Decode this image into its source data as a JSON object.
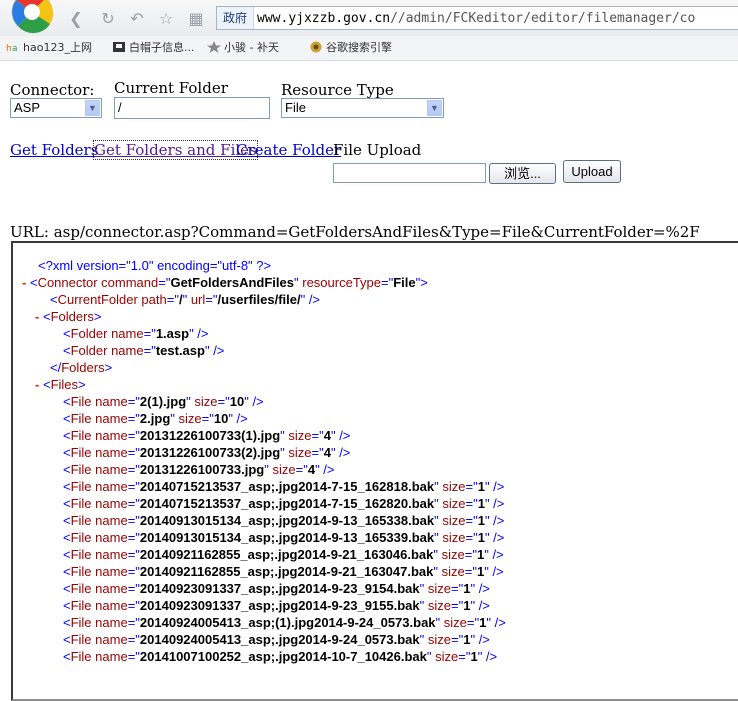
{
  "browser": {
    "zone_label": "政府",
    "address_main": "www.yjxzzb.gov.cn",
    "address_path": "//admin/FCKeditor/editor/filemanager/co",
    "nav_icons": [
      "back-icon",
      "reload-icon",
      "undo-icon",
      "star-icon",
      "grid-icon"
    ],
    "bookmarks": [
      {
        "label": "hao123_上网",
        "icon": "hao123-icon"
      },
      {
        "label": "白帽子信息...",
        "icon": "hat-icon"
      },
      {
        "label": "小骏 - 补天",
        "icon": "star-icon"
      },
      {
        "label": "谷歌搜索引擎",
        "icon": "google-icon"
      }
    ]
  },
  "form": {
    "connector_label": "Connector:",
    "connector_value": "ASP",
    "current_folder_label": "Current Folder",
    "current_folder_value": "/",
    "resource_type_label": "Resource Type",
    "resource_type_value": "File",
    "links": {
      "get_folders": "Get Folders",
      "get_folders_and_files": "Get Folders and Files",
      "create_folder": "Create Folder"
    },
    "file_upload_label": "File Upload",
    "browse_label": "浏览...",
    "upload_label": "Upload"
  },
  "request_url": "URL: asp/connector.asp?Command=GetFoldersAndFiles&Type=File&CurrentFolder=%2F",
  "xml": {
    "declaration": "<?xml version=\"1.0\" encoding=\"utf-8\" ?>",
    "minus": "-",
    "connector_command": "GetFoldersAndFiles",
    "connector_resource_type": "File",
    "current_folder_path": "/",
    "current_folder_url": "/userfiles/file/",
    "folders": [
      "1.asp",
      "test.asp"
    ],
    "files": [
      {
        "name": "2(1).jpg",
        "size": "10"
      },
      {
        "name": "2.jpg",
        "size": "10"
      },
      {
        "name": "20131226100733(1).jpg",
        "size": "4"
      },
      {
        "name": "20131226100733(2).jpg",
        "size": "4"
      },
      {
        "name": "20131226100733.jpg",
        "size": "4"
      },
      {
        "name": "20140715213537_asp;.jpg2014-7-15_162818.bak",
        "size": "1"
      },
      {
        "name": "20140715213537_asp;.jpg2014-7-15_162820.bak",
        "size": "1"
      },
      {
        "name": "20140913015134_asp;.jpg2014-9-13_165338.bak",
        "size": "1"
      },
      {
        "name": "20140913015134_asp;.jpg2014-9-13_165339.bak",
        "size": "1"
      },
      {
        "name": "20140921162855_asp;.jpg2014-9-21_163046.bak",
        "size": "1"
      },
      {
        "name": "20140921162855_asp;.jpg2014-9-21_163047.bak",
        "size": "1"
      },
      {
        "name": "20140923091337_asp;.jpg2014-9-23_9154.bak",
        "size": "1"
      },
      {
        "name": "20140923091337_asp;.jpg2014-9-23_9155.bak",
        "size": "1"
      },
      {
        "name": "20140924005413_asp;(1).jpg2014-9-24_0573.bak",
        "size": "1"
      },
      {
        "name": "20140924005413_asp;.jpg2014-9-24_0573.bak",
        "size": "1"
      },
      {
        "name": "20141007100252_asp;.jpg2014-10-7_10426.bak",
        "size": "1"
      }
    ]
  }
}
